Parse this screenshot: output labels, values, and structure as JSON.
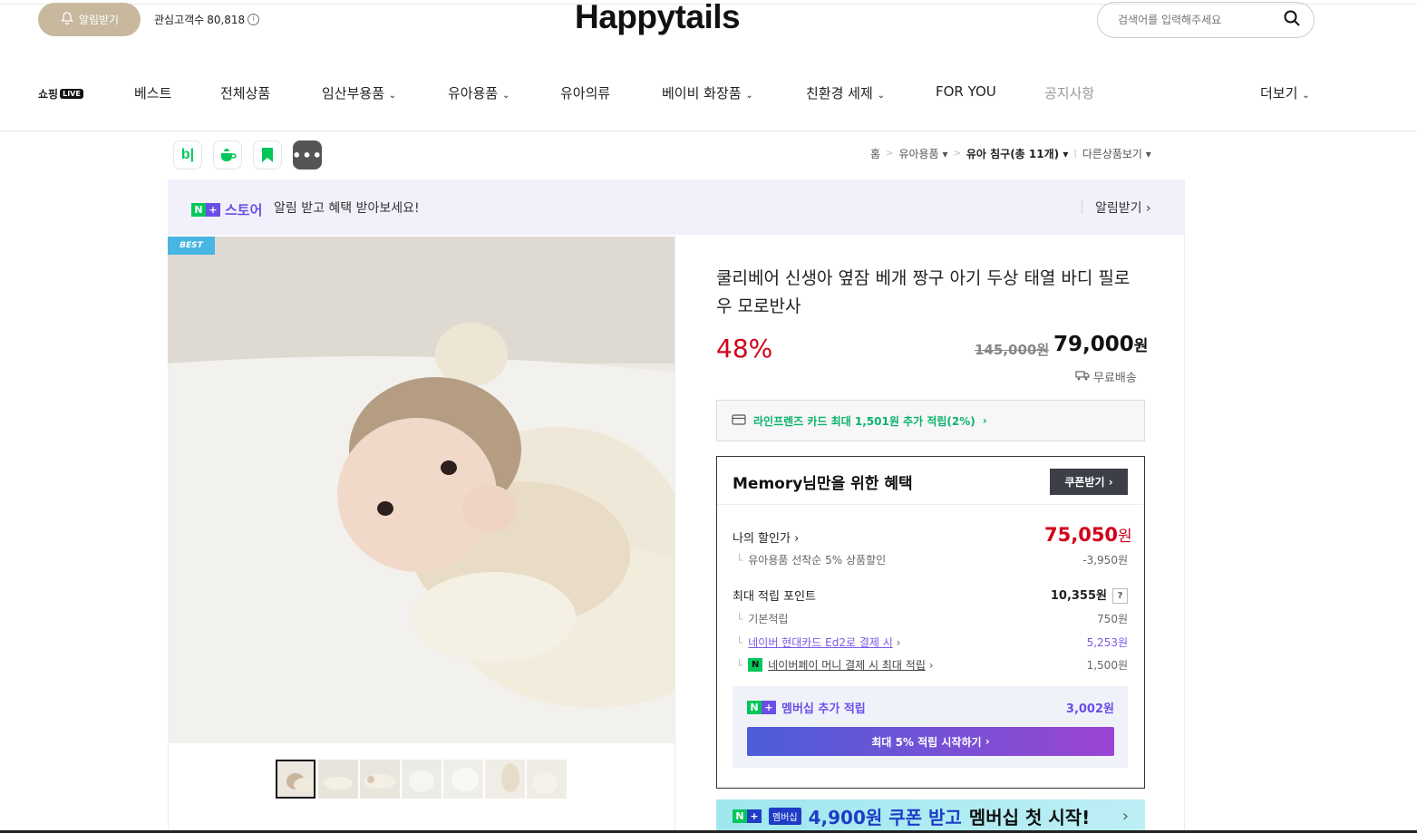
{
  "header": {
    "alarm_button": "알림받기",
    "followers_label": "관심고객수",
    "followers_count": "80,818",
    "logo": "Happytails",
    "search_placeholder": "검색어를 입력해주세요"
  },
  "nav": {
    "live_logo": "쇼핑",
    "live_badge": "LIVE",
    "items": [
      "베스트",
      "전체상품",
      "임산부용품",
      "유아용품",
      "유아의류",
      "베이비 화장품",
      "친환경 세제",
      "FOR YOU",
      "공지사항",
      "더보기"
    ]
  },
  "breadcrumb": {
    "home": "홈",
    "category": "유아용품",
    "current": "유아 침구(총 11개)",
    "other": "다른상품보기"
  },
  "notice": {
    "store_label": "스토어",
    "text": "알림 받고 혜택 받아보세요!",
    "link": "알림받기"
  },
  "product": {
    "badge": "BEST",
    "title": "쿨리베어 신생아 옆잠 베개 짱구 아기 두상 태열 바디 필로우 모로반사",
    "discount": "48%",
    "original_price": "145,000원",
    "sale_price_num": "79,000",
    "won": "원",
    "shipping": "무료배송",
    "card_benefit": "라인프렌즈 카드 최대 1,501원 추가 적립(2%)"
  },
  "benefit": {
    "title": "Memory님만을 위한 혜택",
    "coupon_button": "쿠폰받기",
    "my_price_label": "나의 할인가",
    "my_price_num": "75,050",
    "my_price_unit": "원",
    "discount_detail_label": "유아용품 선착순 5% 상품할인",
    "discount_detail_val": "-3,950원",
    "max_point_label": "최대 적립 포인트",
    "max_point_val": "10,355원",
    "help": "?",
    "base_label": "기본적립",
    "base_val": "750원",
    "hyundai_label": "네이버 현대카드 Ed2로 결제 시",
    "hyundai_val": "5,253원",
    "npay_label": "네이버페이 머니 결제 시 최대 적립",
    "npay_val": "1,500원",
    "member_label": "멤버십 추가 적립",
    "member_val": "3,002원",
    "member_button": "최대 5% 적립 시작하기"
  },
  "bottom_banner": {
    "tag": "멤버십",
    "highlight": "4,900원 쿠폰 받고",
    "text": "멤버십 첫 시작!"
  },
  "colors": {
    "accent_red": "#d0021b",
    "naver_green": "#03c75a",
    "purple": "#7b56e6"
  }
}
